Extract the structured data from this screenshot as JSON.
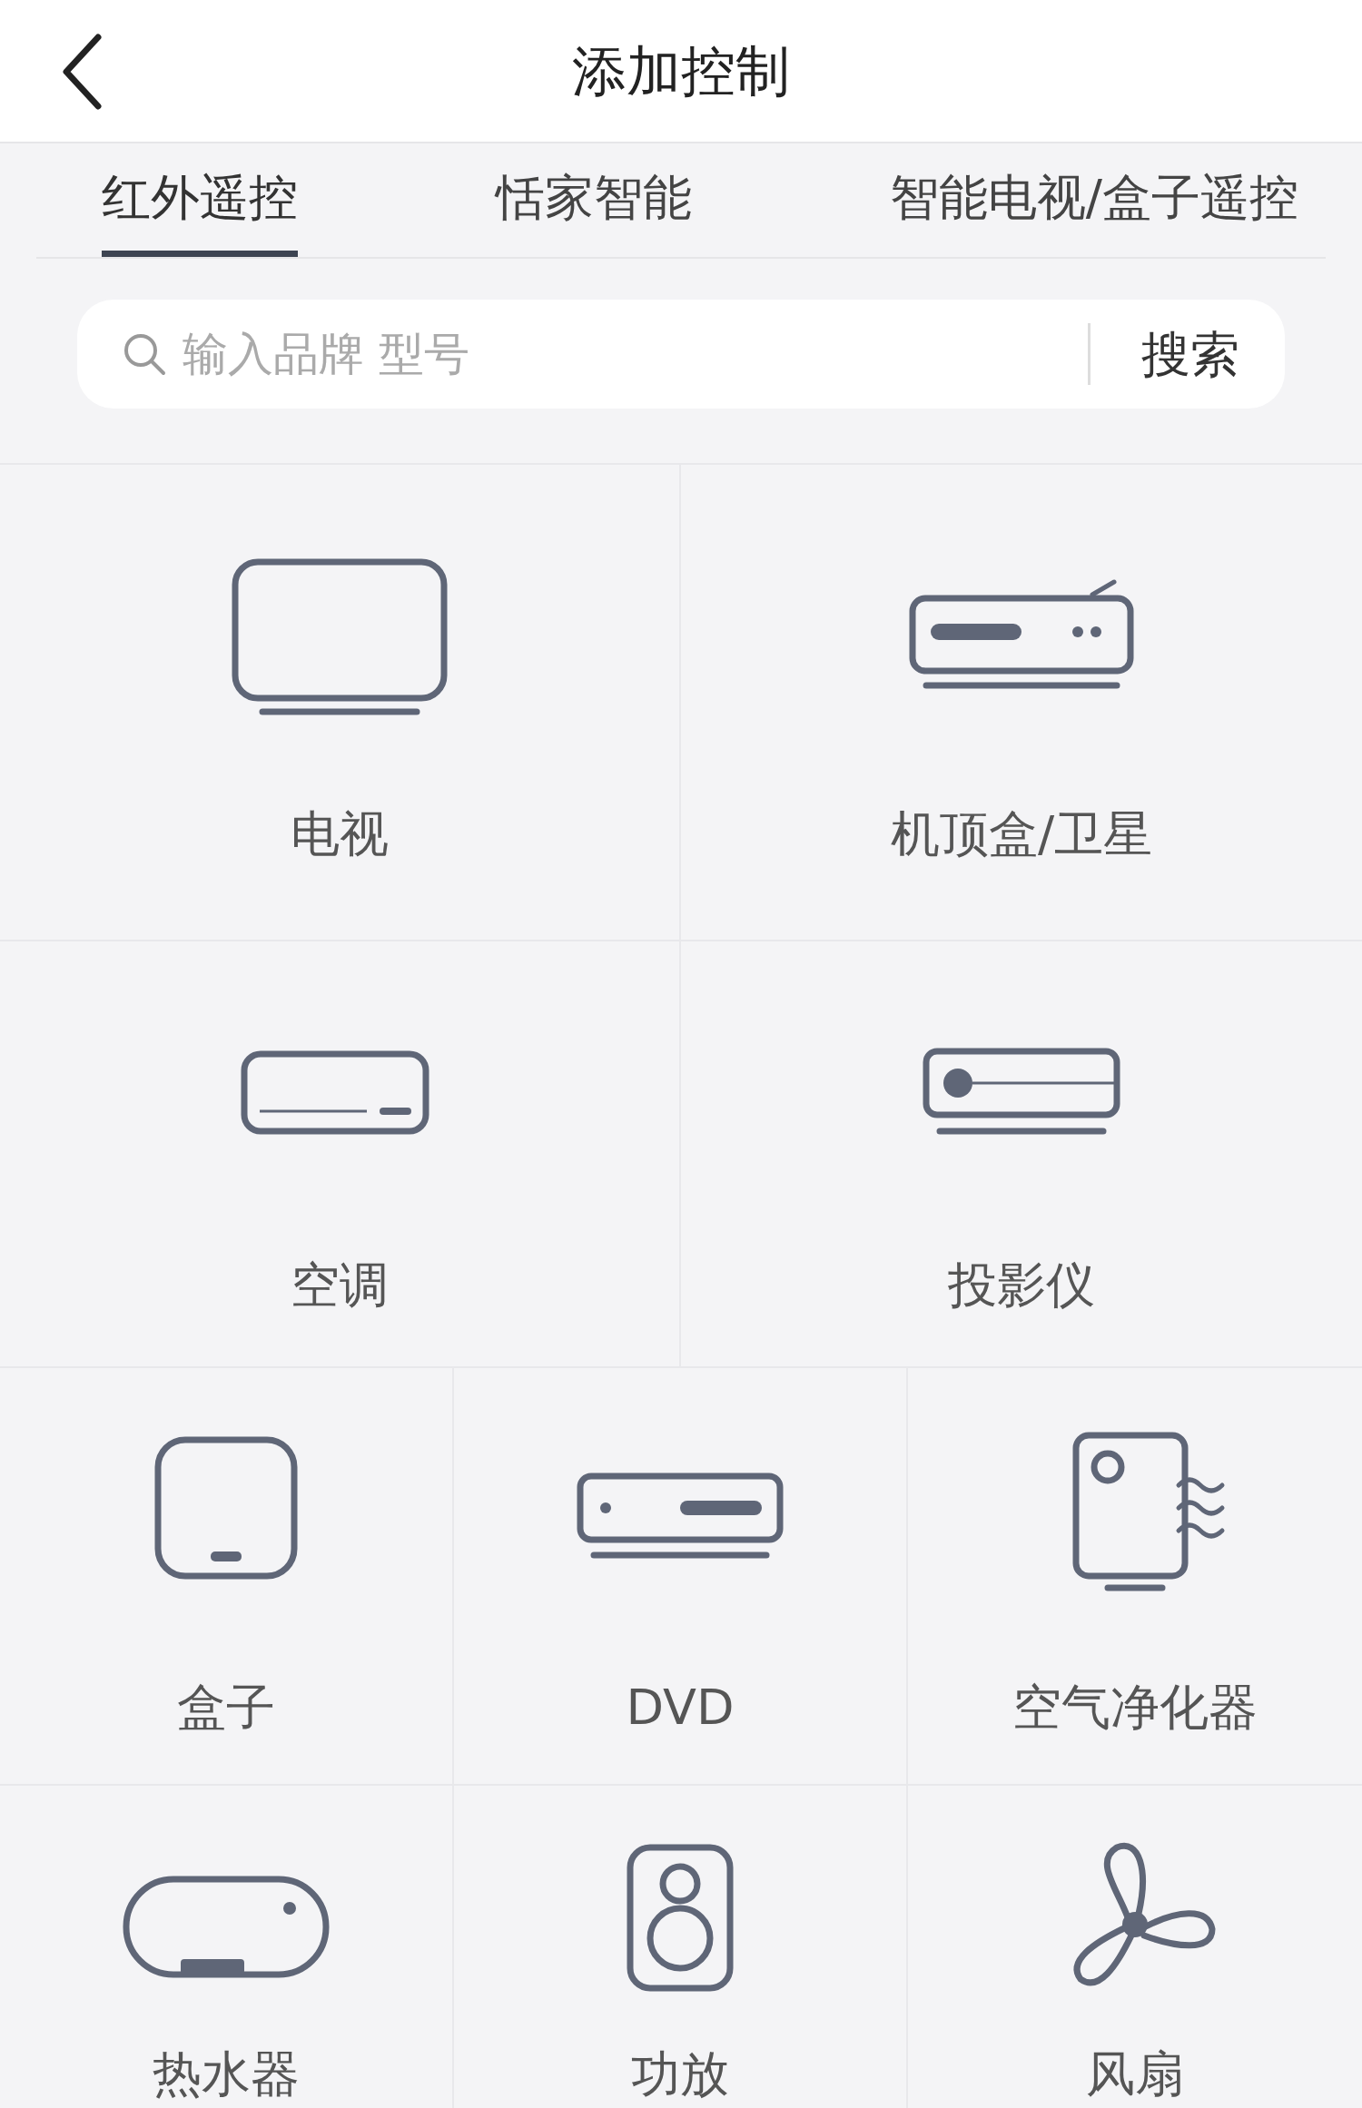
{
  "header": {
    "title": "添加控制"
  },
  "tabs": [
    {
      "label": "红外遥控",
      "selected": true
    },
    {
      "label": "恬家智能",
      "selected": false
    },
    {
      "label": "智能电视/盒子遥控",
      "selected": false
    }
  ],
  "search": {
    "placeholder": "输入品牌 型号",
    "button": "搜索"
  },
  "device_rows": [
    [
      {
        "label": "电视",
        "kind": "tv"
      },
      {
        "label": "机顶盒/卫星",
        "kind": "settop"
      }
    ],
    [
      {
        "label": "空调",
        "kind": "ac"
      },
      {
        "label": "投影仪",
        "kind": "projector"
      }
    ],
    [
      {
        "label": "盒子",
        "kind": "box"
      },
      {
        "label": "DVD",
        "kind": "dvd"
      },
      {
        "label": "空气净化器",
        "kind": "purifier"
      }
    ],
    [
      {
        "label": "热水器",
        "kind": "heater"
      },
      {
        "label": "功放",
        "kind": "speaker"
      },
      {
        "label": "风扇",
        "kind": "fan"
      }
    ]
  ]
}
